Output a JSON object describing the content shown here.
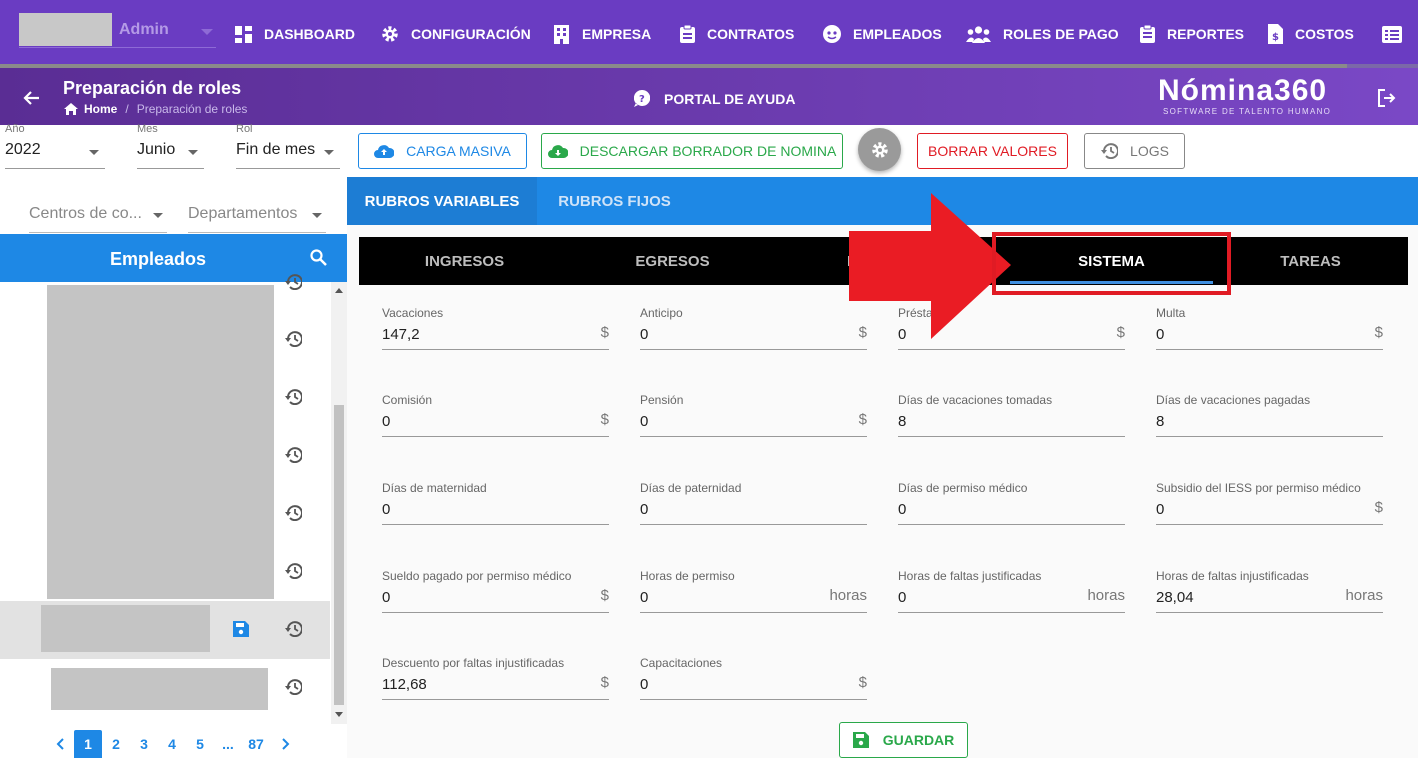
{
  "header": {
    "user_role": "Admin",
    "nav": [
      {
        "label": "DASHBOARD",
        "icon": "dashboard-icon"
      },
      {
        "label": "CONFIGURACIÓN",
        "icon": "gear-icon"
      },
      {
        "label": "EMPRESA",
        "icon": "building-icon"
      },
      {
        "label": "CONTRATOS",
        "icon": "clipboard-icon"
      },
      {
        "label": "EMPLEADOS",
        "icon": "face-icon"
      },
      {
        "label": "ROLES DE PAGO",
        "icon": "group-icon"
      },
      {
        "label": "REPORTES",
        "icon": "clipboard-list-icon"
      },
      {
        "label": "COSTOS",
        "icon": "invoice-icon"
      }
    ],
    "progress": 0.95
  },
  "subheader": {
    "title": "Preparación de roles",
    "breadcrumb": {
      "home": "Home",
      "current": "Preparación de roles"
    },
    "help": "PORTAL DE AYUDA",
    "logo": "Nómina360",
    "logo_sub": "SOFTWARE DE TALENTO HUMANO"
  },
  "filters": {
    "year": {
      "label": "Año",
      "value": "2022"
    },
    "month": {
      "label": "Mes",
      "value": "Junio"
    },
    "role": {
      "label": "Rol",
      "value": "Fin de mes"
    },
    "centers": "Centros de co...",
    "departments": "Departamentos"
  },
  "actions": {
    "bulk": "CARGA MASIVA",
    "download": "DESCARGAR BORRADOR DE NOMINA",
    "clear": "BORRAR VALORES",
    "logs": "LOGS"
  },
  "employees": {
    "title": "Empleados",
    "pages": [
      "1",
      "2",
      "3",
      "4",
      "5",
      "...",
      "87"
    ],
    "current_page": "1"
  },
  "tabs": {
    "top": [
      "RUBROS VARIABLES",
      "RUBROS FIJOS"
    ],
    "inner": [
      "INGRESOS",
      "EGRESOS",
      "P",
      "SISTEMA",
      "TAREAS"
    ]
  },
  "fields": [
    {
      "label": "Vacaciones",
      "value": "147,2",
      "suffix": "$"
    },
    {
      "label": "Anticipo",
      "value": "0",
      "suffix": "$"
    },
    {
      "label": "Présta",
      "value": "0",
      "suffix": "$"
    },
    {
      "label": "Multa",
      "value": "0",
      "suffix": "$"
    },
    {
      "label": "Comisión",
      "value": "0",
      "suffix": "$"
    },
    {
      "label": "Pensión",
      "value": "0",
      "suffix": "$"
    },
    {
      "label": "Días de vacaciones tomadas",
      "value": "8",
      "suffix": ""
    },
    {
      "label": "Días de vacaciones pagadas",
      "value": "8",
      "suffix": ""
    },
    {
      "label": "Días de maternidad",
      "value": "0",
      "suffix": ""
    },
    {
      "label": "Días de paternidad",
      "value": "0",
      "suffix": ""
    },
    {
      "label": "Días de permiso médico",
      "value": "0",
      "suffix": ""
    },
    {
      "label": "Subsidio del IESS por permiso médico",
      "value": "0",
      "suffix": "$"
    },
    {
      "label": "Sueldo pagado por permiso médico",
      "value": "0",
      "suffix": "$"
    },
    {
      "label": "Horas de permiso",
      "value": "0",
      "suffix": "horas"
    },
    {
      "label": "Horas de faltas justificadas",
      "value": "0",
      "suffix": "horas"
    },
    {
      "label": "Horas de faltas injustificadas",
      "value": "28,04",
      "suffix": "horas"
    },
    {
      "label": "Descuento por faltas injustificadas",
      "value": "112,68",
      "suffix": "$"
    },
    {
      "label": "Capacitaciones",
      "value": "0",
      "suffix": "$"
    }
  ],
  "save": "GUARDAR",
  "colors": {
    "purple": "#6a3cc2",
    "blue": "#1e88e5",
    "green": "#2aa84a",
    "red": "#e01b24"
  }
}
